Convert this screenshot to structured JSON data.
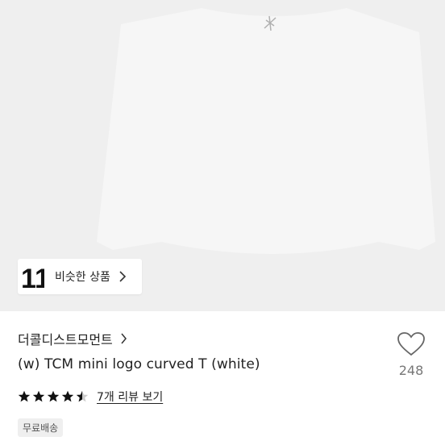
{
  "product": {
    "image_icon": "shirt-image",
    "similar_button_label": "비슷한 상품",
    "similar_logo": "11",
    "brand": "더콜디스트모먼트",
    "title": "(w) TCM mini logo curved T (white)",
    "likes": "248",
    "rating": 4.5,
    "review_link": "7개 리뷰 보기",
    "badge": "무료배송"
  }
}
